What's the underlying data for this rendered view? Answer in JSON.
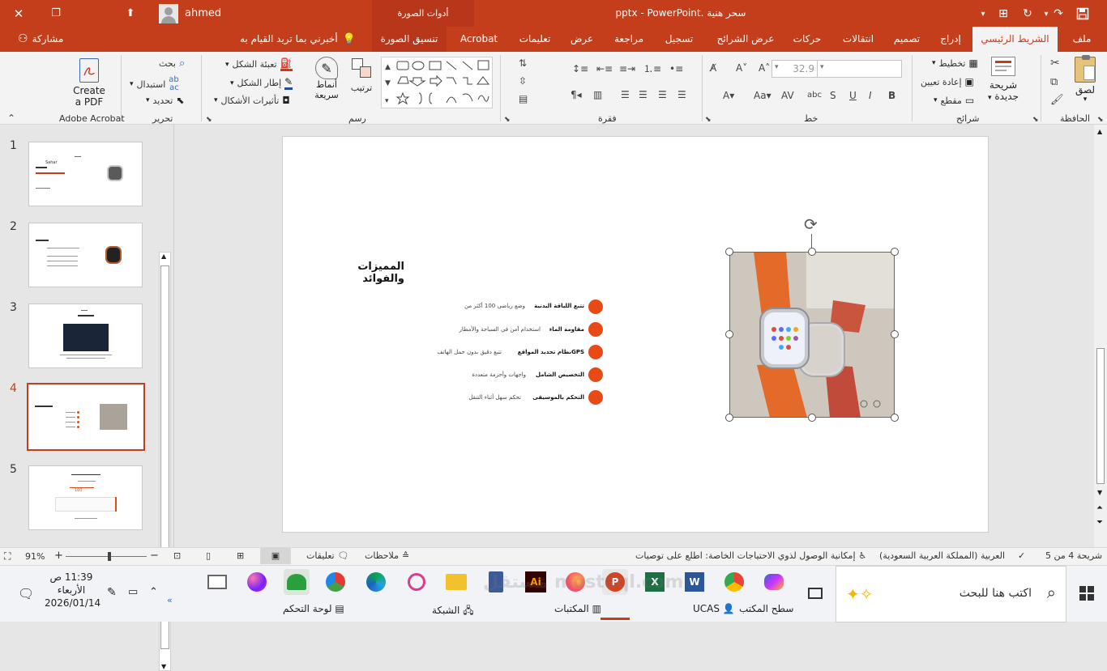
{
  "window": {
    "title": "سحر هنية .pptx  -  PowerPoint",
    "user": "ahmed",
    "contextual_group": "أدوات الصورة",
    "colors": {
      "accent": "#c43e1c",
      "ribbon": "#f3f3f3",
      "bullet": "#e84a17"
    }
  },
  "tabs": {
    "file": "ملف",
    "home": "الشريط الرئيسي",
    "insert": "إدراج",
    "design": "تصميم",
    "transitions": "انتقالات",
    "animations": "حركات",
    "slideshow": "عرض الشرائح",
    "record": "تسجيل",
    "review": "مراجعة",
    "view": "عرض",
    "help": "تعليمات",
    "acrobat": "Acrobat",
    "picture_format": "تنسيق الصورة",
    "tell_me": "أخبرني بما تريد القيام به",
    "share": "مشاركة"
  },
  "ribbon": {
    "clipboard": {
      "name": "الحافظة",
      "paste": "لصق"
    },
    "slides": {
      "name": "شرائح",
      "new_slide_1": "شريحة",
      "new_slide_2": "جديدة",
      "layout": "تخطيط",
      "reset": "إعادة تعيين",
      "section": "مقطع"
    },
    "font": {
      "name": "خط",
      "size": "32.9"
    },
    "paragraph": {
      "name": "فقرة"
    },
    "drawing": {
      "name": "رسم",
      "arrange": "ترتيب",
      "quick_styles_1": "أنماط",
      "quick_styles_2": "سريعة",
      "shape_fill": "تعبئة الشكل",
      "shape_outline": "إطار الشكل",
      "shape_effects": "تأثيرات الأشكال"
    },
    "editing": {
      "name": "تحرير",
      "find": "بحث",
      "replace": "استبدال",
      "select": "تحديد"
    },
    "acrobat": {
      "name": "Adobe Acrobat",
      "create_1": "Create",
      "create_2": "a PDF"
    }
  },
  "thumbnails": [
    {
      "num": "1",
      "text": "Sahar"
    },
    {
      "num": "2",
      "text": ""
    },
    {
      "num": "3",
      "text": ""
    },
    {
      "num": "4",
      "text": ""
    },
    {
      "num": "5",
      "text": "100"
    }
  ],
  "slide": {
    "title": "المميزات والفوائد",
    "items": [
      {
        "label": "تتبع اللياقة البدنية",
        "desc": "وضع رياضي 100 أكثر من"
      },
      {
        "label": "مقاومة الماء",
        "desc": "استخدام آمن في السباحة والأمطار"
      },
      {
        "label": "GPSنظام تحديد المواقع",
        "desc": "تتبع دقيق بدون حمل الهاتف"
      },
      {
        "label": "التخصيص الشامل",
        "desc": "واجهات وأحزمة متعددة"
      },
      {
        "label": "التحكم بالموسيقى",
        "desc": "تحكم سهل أثناء التنقل"
      }
    ]
  },
  "status": {
    "slide_of": "شريحة 4 من 5",
    "language": "العربية (المملكة العربية السعودية)",
    "accessibility": "إمكانية الوصول لذوي الاحتياجات الخاصة: اطلع على توصيات",
    "notes": "ملاحظات",
    "comments": "تعليقات",
    "zoom": "91%"
  },
  "taskbar": {
    "search_placeholder": "اكتب هنا للبحث",
    "time": "11:39 ص",
    "day": "الأربعاء",
    "date": "2026/01/14",
    "desktop": "سطح المكتب",
    "ucas": "UCAS",
    "libraries": "المكتبات",
    "network": "الشبكة",
    "control_panel": "لوحة التحكم",
    "watermark": "مستقل mostaql.com"
  }
}
